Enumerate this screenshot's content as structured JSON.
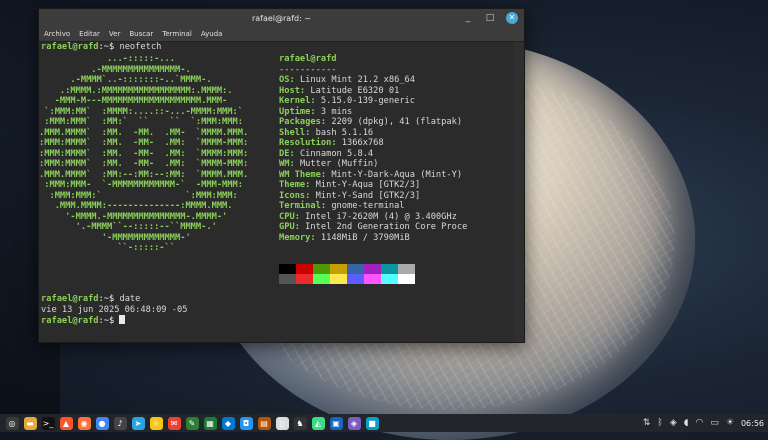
{
  "window": {
    "title": "rafael@rafd: ~",
    "buttons": {
      "minimize": "_",
      "maximize": "□",
      "close": "✕"
    },
    "menu": [
      "Archivo",
      "Editar",
      "Ver",
      "Buscar",
      "Terminal",
      "Ayuda"
    ]
  },
  "terminal": {
    "prompt_user": "rafael@rafd",
    "prompt_sep": ":~$ ",
    "cmd1": "neofetch",
    "cmd2": "date",
    "date_output": "vie 13 jun 2025 06:48:09 -05",
    "art": [
      "             ...-:::::-...",
      "          .-MMMMMMMMMMMMMMM-.",
      "      .-MMMM`..-:::::::-..`MMMM-.",
      "    .:MMMM.:MMMMMMMMMMMMMMMMM:.MMMM:.",
      "   -MMM-M---MMMMMMMMMMMMMMMMMMM.MMM-",
      " `:MMM:MM`  :MMMM:....::-...-MMMM:MMM:`",
      " :MMM:MMM`  :MM:`  ``    ``  `:MMM:MMM:",
      ".MMM.MMMM`  :MM.  -MM.  .MM-  `MMMM.MMM.",
      ":MMM:MMMM`  :MM.  -MM-  .MM:  `MMMM-MMM:",
      ":MMM:MMMM`  :MM.  -MM-  .MM:  `MMMM:MMM:",
      ":MMM:MMMM`  :MM.  -MM-  .MM:  `MMMM-MMM:",
      ".MMM.MMMM`  :MM:--:MM:--:MM:  `MMMM.MMM.",
      " :MMM:MMM-  `-MMMMMMMMMMMM-`  -MMM-MMM:",
      "  :MMM:MMM:`                `:MMM:MMM:",
      "   .MMM.MMMM:--------------:MMMM.MMM.",
      "     '-MMMM.-MMMMMMMMMMMMMMM-.MMMM-'",
      "       '.-MMMM``--:::::--``MMMM-.'",
      "            '-MMMMMMMMMMMMM-'",
      "               ``-:::::-``"
    ],
    "info": {
      "user": "rafael@rafd",
      "rule": "-----------",
      "lines": [
        {
          "k": "OS",
          "v": "Linux Mint 21.2 x86_64"
        },
        {
          "k": "Host",
          "v": "Latitude E6320 01"
        },
        {
          "k": "Kernel",
          "v": "5.15.0-139-generic"
        },
        {
          "k": "Uptime",
          "v": "3 mins"
        },
        {
          "k": "Packages",
          "v": "2209 (dpkg), 41 (flatpak)"
        },
        {
          "k": "Shell",
          "v": "bash 5.1.16"
        },
        {
          "k": "Resolution",
          "v": "1366x768"
        },
        {
          "k": "DE",
          "v": "Cinnamon 5.8.4"
        },
        {
          "k": "WM",
          "v": "Mutter (Muffin)"
        },
        {
          "k": "WM Theme",
          "v": "Mint-Y-Dark-Aqua (Mint-Y)"
        },
        {
          "k": "Theme",
          "v": "Mint-Y-Aqua [GTK2/3]"
        },
        {
          "k": "Icons",
          "v": "Mint-Y-Sand [GTK2/3]"
        },
        {
          "k": "Terminal",
          "v": "gnome-terminal"
        },
        {
          "k": "CPU",
          "v": "Intel i7-2620M (4) @ 3.400GHz"
        },
        {
          "k": "GPU",
          "v": "Intel 2nd Generation Core Proce"
        },
        {
          "k": "Memory",
          "v": "1148MiB / 3790MiB"
        }
      ]
    },
    "palette_top": [
      "#000000",
      "#cc0000",
      "#4e9a06",
      "#c4a000",
      "#3465a4",
      "#a020c0",
      "#06989a",
      "#aaaaaa"
    ],
    "palette_bottom": [
      "#555555",
      "#ef2929",
      "#55ff55",
      "#fce94f",
      "#5c5cff",
      "#ff55ff",
      "#55ffff",
      "#ffffff"
    ]
  },
  "taskbar": {
    "icons": [
      {
        "name": "mint-menu-icon",
        "color": "#3a3a3a",
        "glyph": "◎"
      },
      {
        "name": "files-icon",
        "color": "#e2a93b",
        "glyph": "▬"
      },
      {
        "name": "terminal-icon",
        "color": "#111111",
        "glyph": ">_"
      },
      {
        "name": "brave-icon",
        "color": "#fb542b",
        "glyph": "▲"
      },
      {
        "name": "firefox-icon",
        "color": "#ff7139",
        "glyph": "◉"
      },
      {
        "name": "chrome-icon",
        "color": "#4285f4",
        "glyph": "●"
      },
      {
        "name": "music-icon",
        "color": "#444444",
        "glyph": "♪"
      },
      {
        "name": "telegram-icon",
        "color": "#2aa3e2",
        "glyph": "➤"
      },
      {
        "name": "bulb-icon",
        "color": "#f5c518",
        "glyph": "☼"
      },
      {
        "name": "mail-icon",
        "color": "#ea4335",
        "glyph": "✉"
      },
      {
        "name": "editor-icon",
        "color": "#2e7d32",
        "glyph": "✎"
      },
      {
        "name": "sheet-icon",
        "color": "#1f7a3a",
        "glyph": "▦"
      },
      {
        "name": "vscode-icon",
        "color": "#0078d4",
        "glyph": "◆"
      },
      {
        "name": "camera-icon",
        "color": "#2196f3",
        "glyph": "◘"
      },
      {
        "name": "book-icon",
        "color": "#b45309",
        "glyph": "▤"
      },
      {
        "name": "doc-icon",
        "color": "#dddddd",
        "glyph": "▯"
      },
      {
        "name": "game-icon",
        "color": "#333333",
        "glyph": "♞"
      },
      {
        "name": "android-icon",
        "color": "#3ddc84",
        "glyph": "◭"
      },
      {
        "name": "store-icon",
        "color": "#1565c0",
        "glyph": "▣"
      },
      {
        "name": "chat-icon",
        "color": "#7c5cbf",
        "glyph": "◈"
      },
      {
        "name": "app-icon",
        "color": "#0aa0c8",
        "glyph": "■"
      }
    ],
    "tray": {
      "time": "06:56"
    }
  },
  "colors": {
    "accent": "#8bd05a",
    "terminal_bg": "#2b2b2b",
    "close_btn": "#4aa8d8"
  }
}
